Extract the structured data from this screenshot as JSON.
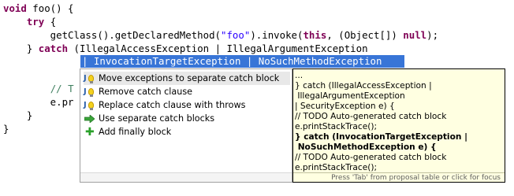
{
  "editor": {
    "lines": [
      {
        "id": "l1",
        "segments": [
          {
            "t": "kw",
            "v": "void"
          },
          {
            "t": "plain",
            "v": " foo() {"
          }
        ]
      },
      {
        "id": "l2",
        "segments": [
          {
            "t": "plain",
            "v": "    "
          },
          {
            "t": "kw",
            "v": "try"
          },
          {
            "t": "plain",
            "v": " {"
          }
        ]
      },
      {
        "id": "l3",
        "segments": [
          {
            "t": "plain",
            "v": "        getClass().getDeclaredMethod("
          },
          {
            "t": "str",
            "v": "\"foo\""
          },
          {
            "t": "plain",
            "v": ").invoke("
          },
          {
            "t": "kw",
            "v": "this"
          },
          {
            "t": "plain",
            "v": ", (Object[]) "
          },
          {
            "t": "kw",
            "v": "null"
          },
          {
            "t": "plain",
            "v": ");"
          }
        ]
      },
      {
        "id": "l4",
        "segments": [
          {
            "t": "plain",
            "v": "    } "
          },
          {
            "t": "kw",
            "v": "catch"
          },
          {
            "t": "plain",
            "v": " (IllegalAccessException | IllegalArgumentException"
          }
        ]
      },
      {
        "id": "l6",
        "segments": [
          {
            "t": "plain",
            "v": "        "
          },
          {
            "t": "cm",
            "v": "// T"
          }
        ]
      },
      {
        "id": "l7",
        "segments": [
          {
            "t": "plain",
            "v": "        e.pr"
          }
        ]
      },
      {
        "id": "l8",
        "segments": [
          {
            "t": "plain",
            "v": "    }"
          }
        ]
      },
      {
        "id": "l9",
        "segments": [
          {
            "t": "plain",
            "v": "}"
          }
        ]
      }
    ],
    "highlighted_line": "| InvocationTargetException | NoSuchMethodException"
  },
  "proposals": {
    "items": [
      {
        "label": "Move exceptions to separate catch block",
        "icon": "quickfix-bulb-icon",
        "selected": true
      },
      {
        "label": "Remove catch clause",
        "icon": "quickfix-bulb-icon",
        "selected": false
      },
      {
        "label": "Replace catch clause with throws",
        "icon": "quickfix-bulb-icon",
        "selected": false
      },
      {
        "label": "Use separate catch blocks",
        "icon": "green-arrow-icon",
        "selected": false
      },
      {
        "label": "Add finally block",
        "icon": "green-plus-icon",
        "selected": false
      }
    ]
  },
  "preview": {
    "lines": [
      {
        "text": "...",
        "bold": false
      },
      {
        "text": "} catch (IllegalAccessException |",
        "bold": false
      },
      {
        "text": " IllegalArgumentException",
        "bold": false
      },
      {
        "text": "| SecurityException e) {",
        "bold": false
      },
      {
        "text": "// TODO Auto-generated catch block",
        "bold": false
      },
      {
        "text": "e.printStackTrace();",
        "bold": false
      },
      {
        "text": "} catch (InvocationTargetException |",
        "bold": true
      },
      {
        "text": " NoSuchMethodException e) {",
        "bold": true
      },
      {
        "text": "// TODO Auto-generated catch block",
        "bold": false
      },
      {
        "text": "e.printStackTrace();",
        "bold": false
      }
    ],
    "status": "Press 'Tab' from proposal table or click for focus"
  },
  "colors": {
    "keyword": "#7f0055",
    "string": "#2a00ff",
    "comment": "#3f7f5f",
    "selection": "#3875d7",
    "preview_bg": "#ffffe1"
  }
}
